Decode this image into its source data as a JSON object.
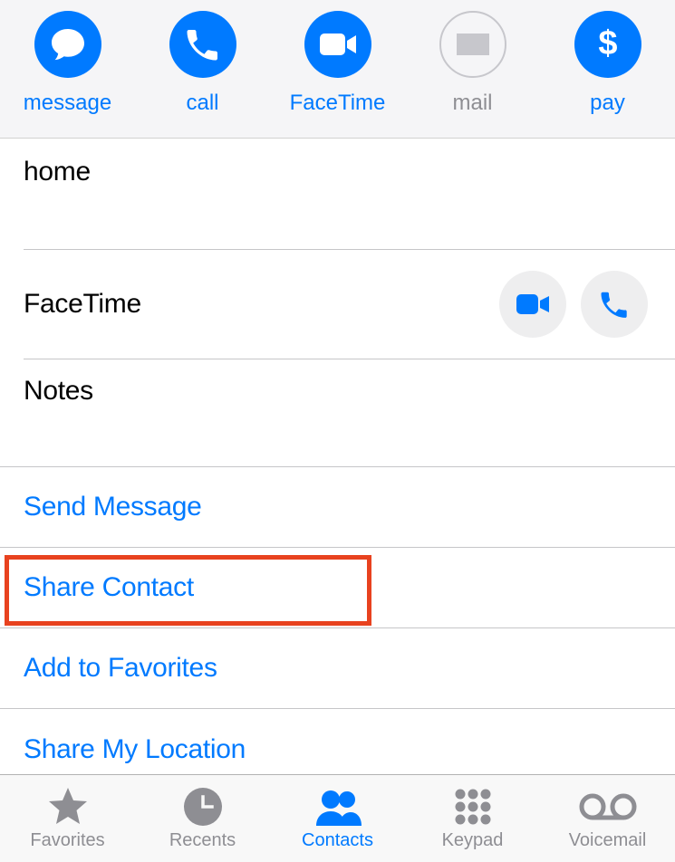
{
  "actions": {
    "message": "message",
    "call": "call",
    "facetime": "FaceTime",
    "mail": "mail",
    "pay": "pay"
  },
  "rows": {
    "home": "home",
    "facetime": "FaceTime",
    "notes": "Notes"
  },
  "links": {
    "send_message": "Send Message",
    "share_contact": "Share Contact",
    "add_favorites": "Add to Favorites",
    "share_location": "Share My Location"
  },
  "tabs": {
    "favorites": "Favorites",
    "recents": "Recents",
    "contacts": "Contacts",
    "keypad": "Keypad",
    "voicemail": "Voicemail"
  },
  "colors": {
    "accent": "#007aff",
    "disabled": "#8e8e93",
    "gray": "#8e8e93",
    "highlight": "#e8421f"
  }
}
